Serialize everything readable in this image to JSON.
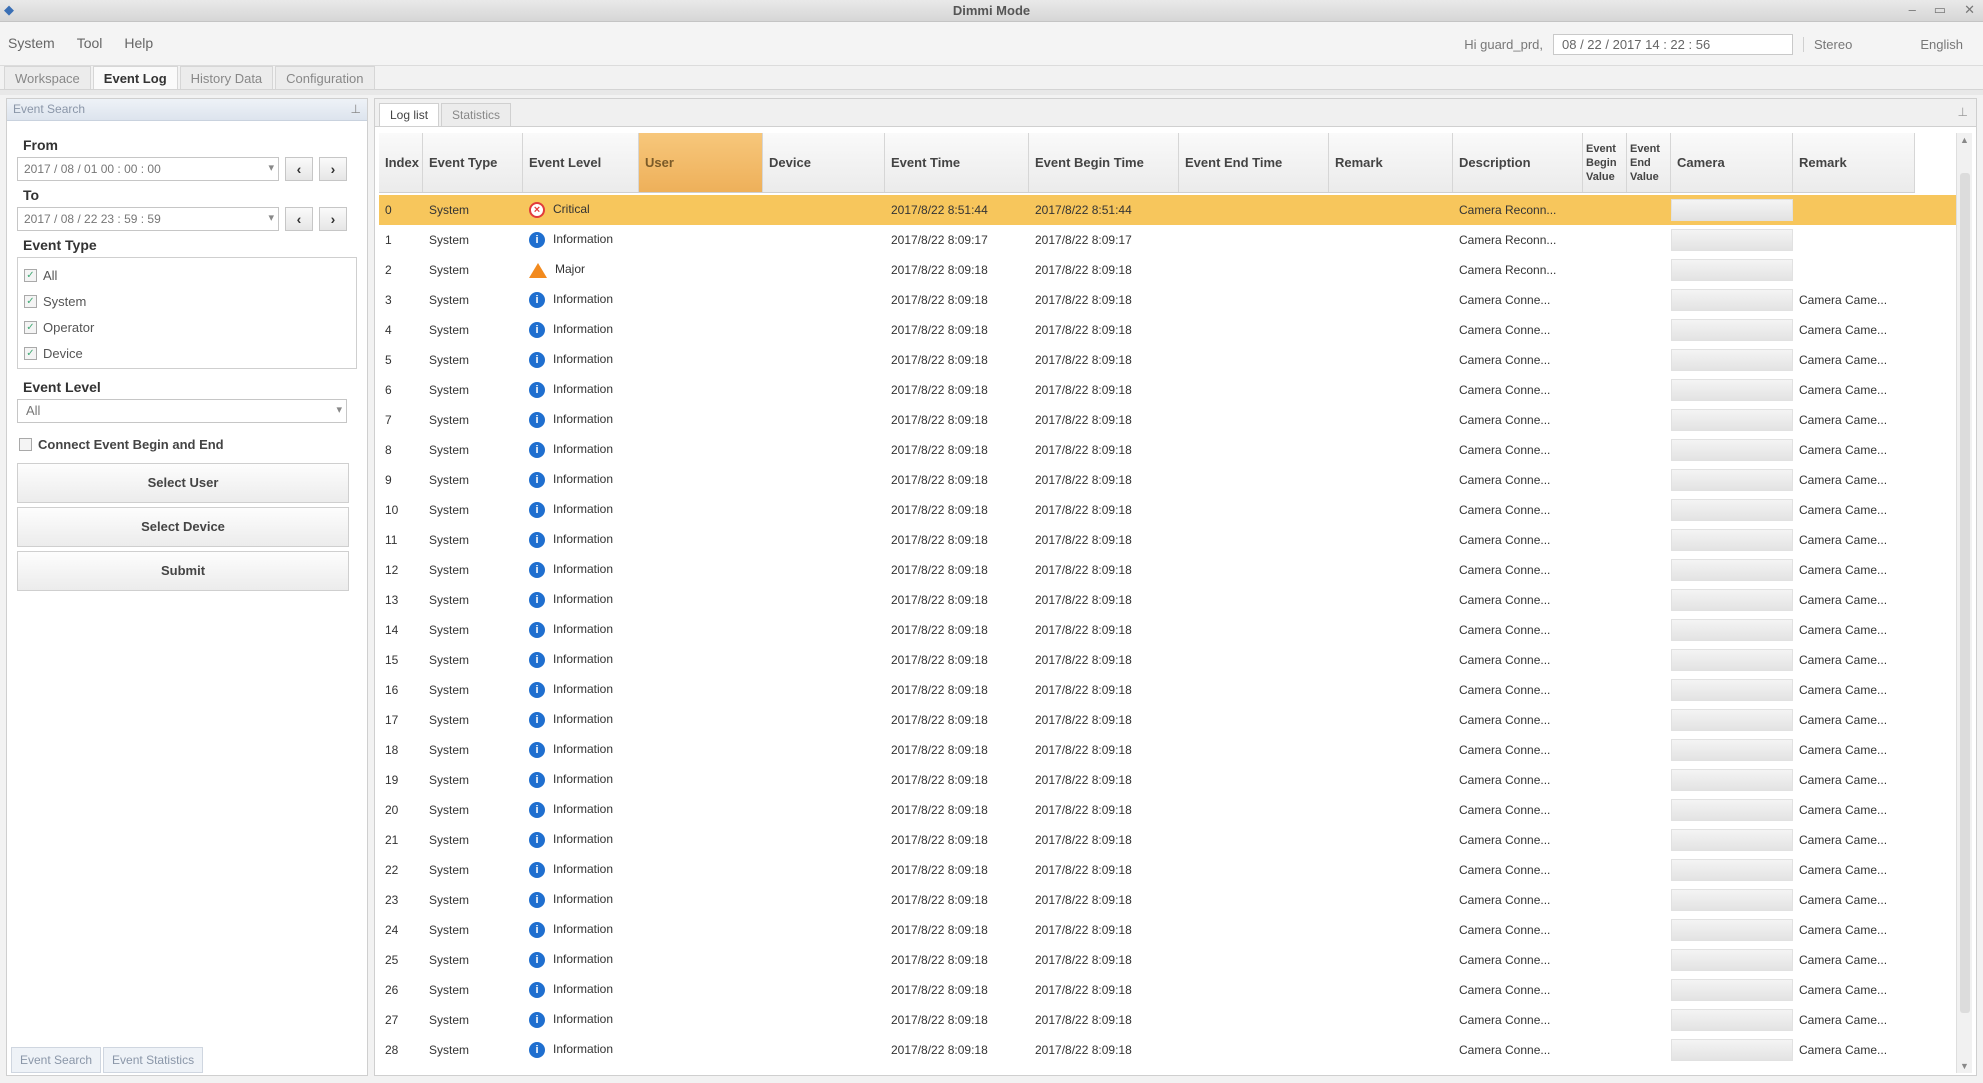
{
  "window": {
    "title": "Dimmi Mode",
    "controls": [
      "–",
      "▭",
      "✕"
    ]
  },
  "menu": [
    "System",
    "Tool",
    "Help"
  ],
  "topbar": {
    "user_label": "Hi guard_prd,",
    "datetime": "08 / 22 / 2017  14 : 22 : 56",
    "language_label": "Stereo",
    "language_value": "English"
  },
  "main_tabs": [
    "Workspace",
    "Event Log",
    "History Data",
    "Configuration"
  ],
  "left_panel": {
    "header": "Event Search",
    "from_label": "From",
    "from_value": "2017 / 08 / 01   00 : 00 : 00",
    "to_label": "To",
    "to_value": "2017 / 08 / 22   23 : 59 : 59",
    "event_type_label": "Event Type",
    "event_types": [
      "All",
      "System",
      "Operator",
      "Device"
    ],
    "event_level_label": "Event Level",
    "event_level_value": "All",
    "connect_label": "Connect Event Begin and End",
    "buttons": {
      "select_user": "Select User",
      "select_device": "Select Device",
      "submit": "Submit"
    },
    "bottom_tabs": [
      "Event Search",
      "Event Statistics"
    ]
  },
  "sub_tabs": [
    "Log list",
    "Statistics"
  ],
  "columns": [
    "Index",
    "Event Type",
    "Event Level",
    "User",
    "Device",
    "Event Time",
    "Event Begin Time",
    "Event End Time",
    "Remark",
    "Description",
    "Event Begin Value",
    "Event End Value",
    "Camera",
    "Remark"
  ],
  "rows": [
    {
      "index": "0",
      "type": "System",
      "level": "Critical",
      "level_icon": "critical",
      "time": "2017/8/22 8:51:44",
      "begin": "2017/8/22 8:51:44",
      "desc": "Camera Reconn...",
      "remark": ""
    },
    {
      "index": "1",
      "type": "System",
      "level": "Information",
      "level_icon": "info",
      "time": "2017/8/22 8:09:17",
      "begin": "2017/8/22 8:09:17",
      "desc": "Camera Reconn...",
      "remark": ""
    },
    {
      "index": "2",
      "type": "System",
      "level": "Major",
      "level_icon": "major",
      "time": "2017/8/22 8:09:18",
      "begin": "2017/8/22 8:09:18",
      "desc": "Camera Reconn...",
      "remark": ""
    },
    {
      "index": "3",
      "type": "System",
      "level": "Information",
      "level_icon": "info",
      "time": "2017/8/22 8:09:18",
      "begin": "2017/8/22 8:09:18",
      "desc": "Camera Conne...",
      "remark": "Camera Came..."
    },
    {
      "index": "4",
      "type": "System",
      "level": "Information",
      "level_icon": "info",
      "time": "2017/8/22 8:09:18",
      "begin": "2017/8/22 8:09:18",
      "desc": "Camera Conne...",
      "remark": "Camera Came..."
    },
    {
      "index": "5",
      "type": "System",
      "level": "Information",
      "level_icon": "info",
      "time": "2017/8/22 8:09:18",
      "begin": "2017/8/22 8:09:18",
      "desc": "Camera Conne...",
      "remark": "Camera Came..."
    },
    {
      "index": "6",
      "type": "System",
      "level": "Information",
      "level_icon": "info",
      "time": "2017/8/22 8:09:18",
      "begin": "2017/8/22 8:09:18",
      "desc": "Camera Conne...",
      "remark": "Camera Came..."
    },
    {
      "index": "7",
      "type": "System",
      "level": "Information",
      "level_icon": "info",
      "time": "2017/8/22 8:09:18",
      "begin": "2017/8/22 8:09:18",
      "desc": "Camera Conne...",
      "remark": "Camera Came..."
    },
    {
      "index": "8",
      "type": "System",
      "level": "Information",
      "level_icon": "info",
      "time": "2017/8/22 8:09:18",
      "begin": "2017/8/22 8:09:18",
      "desc": "Camera Conne...",
      "remark": "Camera Came..."
    },
    {
      "index": "9",
      "type": "System",
      "level": "Information",
      "level_icon": "info",
      "time": "2017/8/22 8:09:18",
      "begin": "2017/8/22 8:09:18",
      "desc": "Camera Conne...",
      "remark": "Camera Came..."
    },
    {
      "index": "10",
      "type": "System",
      "level": "Information",
      "level_icon": "info",
      "time": "2017/8/22 8:09:18",
      "begin": "2017/8/22 8:09:18",
      "desc": "Camera Conne...",
      "remark": "Camera Came..."
    },
    {
      "index": "11",
      "type": "System",
      "level": "Information",
      "level_icon": "info",
      "time": "2017/8/22 8:09:18",
      "begin": "2017/8/22 8:09:18",
      "desc": "Camera Conne...",
      "remark": "Camera Came..."
    },
    {
      "index": "12",
      "type": "System",
      "level": "Information",
      "level_icon": "info",
      "time": "2017/8/22 8:09:18",
      "begin": "2017/8/22 8:09:18",
      "desc": "Camera Conne...",
      "remark": "Camera Came..."
    },
    {
      "index": "13",
      "type": "System",
      "level": "Information",
      "level_icon": "info",
      "time": "2017/8/22 8:09:18",
      "begin": "2017/8/22 8:09:18",
      "desc": "Camera Conne...",
      "remark": "Camera Came..."
    },
    {
      "index": "14",
      "type": "System",
      "level": "Information",
      "level_icon": "info",
      "time": "2017/8/22 8:09:18",
      "begin": "2017/8/22 8:09:18",
      "desc": "Camera Conne...",
      "remark": "Camera Came..."
    },
    {
      "index": "15",
      "type": "System",
      "level": "Information",
      "level_icon": "info",
      "time": "2017/8/22 8:09:18",
      "begin": "2017/8/22 8:09:18",
      "desc": "Camera Conne...",
      "remark": "Camera Came..."
    },
    {
      "index": "16",
      "type": "System",
      "level": "Information",
      "level_icon": "info",
      "time": "2017/8/22 8:09:18",
      "begin": "2017/8/22 8:09:18",
      "desc": "Camera Conne...",
      "remark": "Camera Came..."
    },
    {
      "index": "17",
      "type": "System",
      "level": "Information",
      "level_icon": "info",
      "time": "2017/8/22 8:09:18",
      "begin": "2017/8/22 8:09:18",
      "desc": "Camera Conne...",
      "remark": "Camera Came..."
    },
    {
      "index": "18",
      "type": "System",
      "level": "Information",
      "level_icon": "info",
      "time": "2017/8/22 8:09:18",
      "begin": "2017/8/22 8:09:18",
      "desc": "Camera Conne...",
      "remark": "Camera Came..."
    },
    {
      "index": "19",
      "type": "System",
      "level": "Information",
      "level_icon": "info",
      "time": "2017/8/22 8:09:18",
      "begin": "2017/8/22 8:09:18",
      "desc": "Camera Conne...",
      "remark": "Camera Came..."
    },
    {
      "index": "20",
      "type": "System",
      "level": "Information",
      "level_icon": "info",
      "time": "2017/8/22 8:09:18",
      "begin": "2017/8/22 8:09:18",
      "desc": "Camera Conne...",
      "remark": "Camera Came..."
    },
    {
      "index": "21",
      "type": "System",
      "level": "Information",
      "level_icon": "info",
      "time": "2017/8/22 8:09:18",
      "begin": "2017/8/22 8:09:18",
      "desc": "Camera Conne...",
      "remark": "Camera Came..."
    },
    {
      "index": "22",
      "type": "System",
      "level": "Information",
      "level_icon": "info",
      "time": "2017/8/22 8:09:18",
      "begin": "2017/8/22 8:09:18",
      "desc": "Camera Conne...",
      "remark": "Camera Came..."
    },
    {
      "index": "23",
      "type": "System",
      "level": "Information",
      "level_icon": "info",
      "time": "2017/8/22 8:09:18",
      "begin": "2017/8/22 8:09:18",
      "desc": "Camera Conne...",
      "remark": "Camera Came..."
    },
    {
      "index": "24",
      "type": "System",
      "level": "Information",
      "level_icon": "info",
      "time": "2017/8/22 8:09:18",
      "begin": "2017/8/22 8:09:18",
      "desc": "Camera Conne...",
      "remark": "Camera Came..."
    },
    {
      "index": "25",
      "type": "System",
      "level": "Information",
      "level_icon": "info",
      "time": "2017/8/22 8:09:18",
      "begin": "2017/8/22 8:09:18",
      "desc": "Camera Conne...",
      "remark": "Camera Came..."
    },
    {
      "index": "26",
      "type": "System",
      "level": "Information",
      "level_icon": "info",
      "time": "2017/8/22 8:09:18",
      "begin": "2017/8/22 8:09:18",
      "desc": "Camera Conne...",
      "remark": "Camera Came..."
    },
    {
      "index": "27",
      "type": "System",
      "level": "Information",
      "level_icon": "info",
      "time": "2017/8/22 8:09:18",
      "begin": "2017/8/22 8:09:18",
      "desc": "Camera Conne...",
      "remark": "Camera Came..."
    },
    {
      "index": "28",
      "type": "System",
      "level": "Information",
      "level_icon": "info",
      "time": "2017/8/22 8:09:18",
      "begin": "2017/8/22 8:09:18",
      "desc": "Camera Conne...",
      "remark": "Camera Came..."
    }
  ],
  "colors": {
    "selected_row": "#f7c65c",
    "sorted_header": "#eeb05a",
    "info_icon": "#1f6fcf",
    "critical_icon": "#e23b3b",
    "major_icon": "#f28a1e"
  }
}
